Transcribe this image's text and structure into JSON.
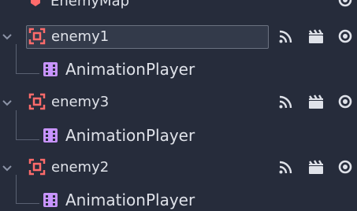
{
  "tree": {
    "partial_top_label": "EnemyMap",
    "nodes": [
      {
        "label": "enemy1",
        "child": "AnimationPlayer",
        "selected": true
      },
      {
        "label": "enemy3",
        "child": "AnimationPlayer",
        "selected": false
      },
      {
        "label": "enemy2",
        "child": "AnimationPlayer",
        "selected": false
      }
    ]
  },
  "icons": {
    "node": "node2d-icon",
    "child": "animation-player-icon",
    "signal": "signal-icon",
    "group": "clapper-icon",
    "visibility": "eye-icon",
    "expand": "chevron-down-icon"
  },
  "colors": {
    "background": "#262c3b",
    "node_icon": "#ff6b6b",
    "child_icon": "#c894ff",
    "text": "#dfe2e9",
    "selection_border": "#6b7280"
  }
}
